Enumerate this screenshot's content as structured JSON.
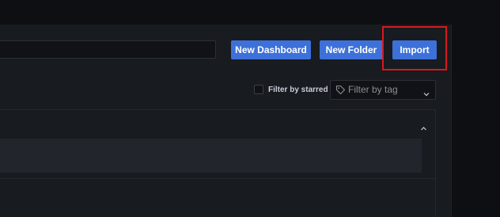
{
  "search": {
    "value": "",
    "placeholder": ""
  },
  "toolbar": {
    "new_dashboard_label": "New Dashboard",
    "new_folder_label": "New Folder",
    "import_label": "Import"
  },
  "filters": {
    "starred_label": "Filter by starred",
    "starred_checked": false,
    "tag_placeholder": "Filter by tag",
    "tag_icon": "tag-icon",
    "dropdown_icon": "chevron-down-icon"
  },
  "folder": {
    "collapse_icon": "chevron-up-icon"
  },
  "colors": {
    "primary_button": "#3d71d9",
    "highlight": "#d71920",
    "panel_background": "#181b1f",
    "page_background": "#0e0f12"
  }
}
